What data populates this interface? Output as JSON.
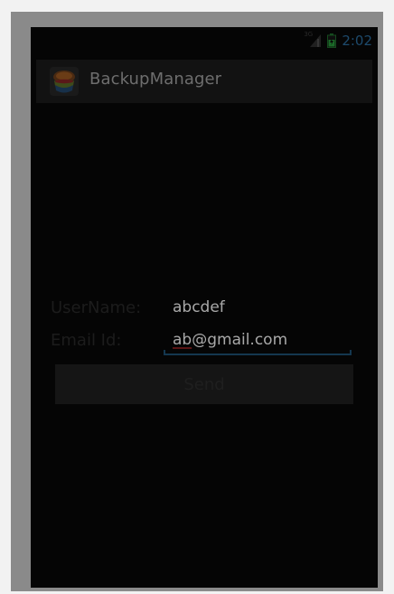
{
  "status_bar": {
    "network_type": "3G",
    "time": "2:02"
  },
  "action_bar": {
    "title": "BackupManager",
    "icon": "app-launcher-icon"
  },
  "form": {
    "username_label": "UserName:",
    "username_value": "abcdef",
    "email_label": "Email Id:",
    "email_value_prefix": "ab",
    "email_value_suffix": "@gmail.com",
    "send_label": "Send"
  },
  "colors": {
    "screen_bg": "#050505",
    "action_bar_bg": "#121212",
    "clock": "#1d4a6c",
    "focus_underline": "#14374f",
    "spellcheck_underline": "#5a1414",
    "button_bg": "#151515"
  }
}
